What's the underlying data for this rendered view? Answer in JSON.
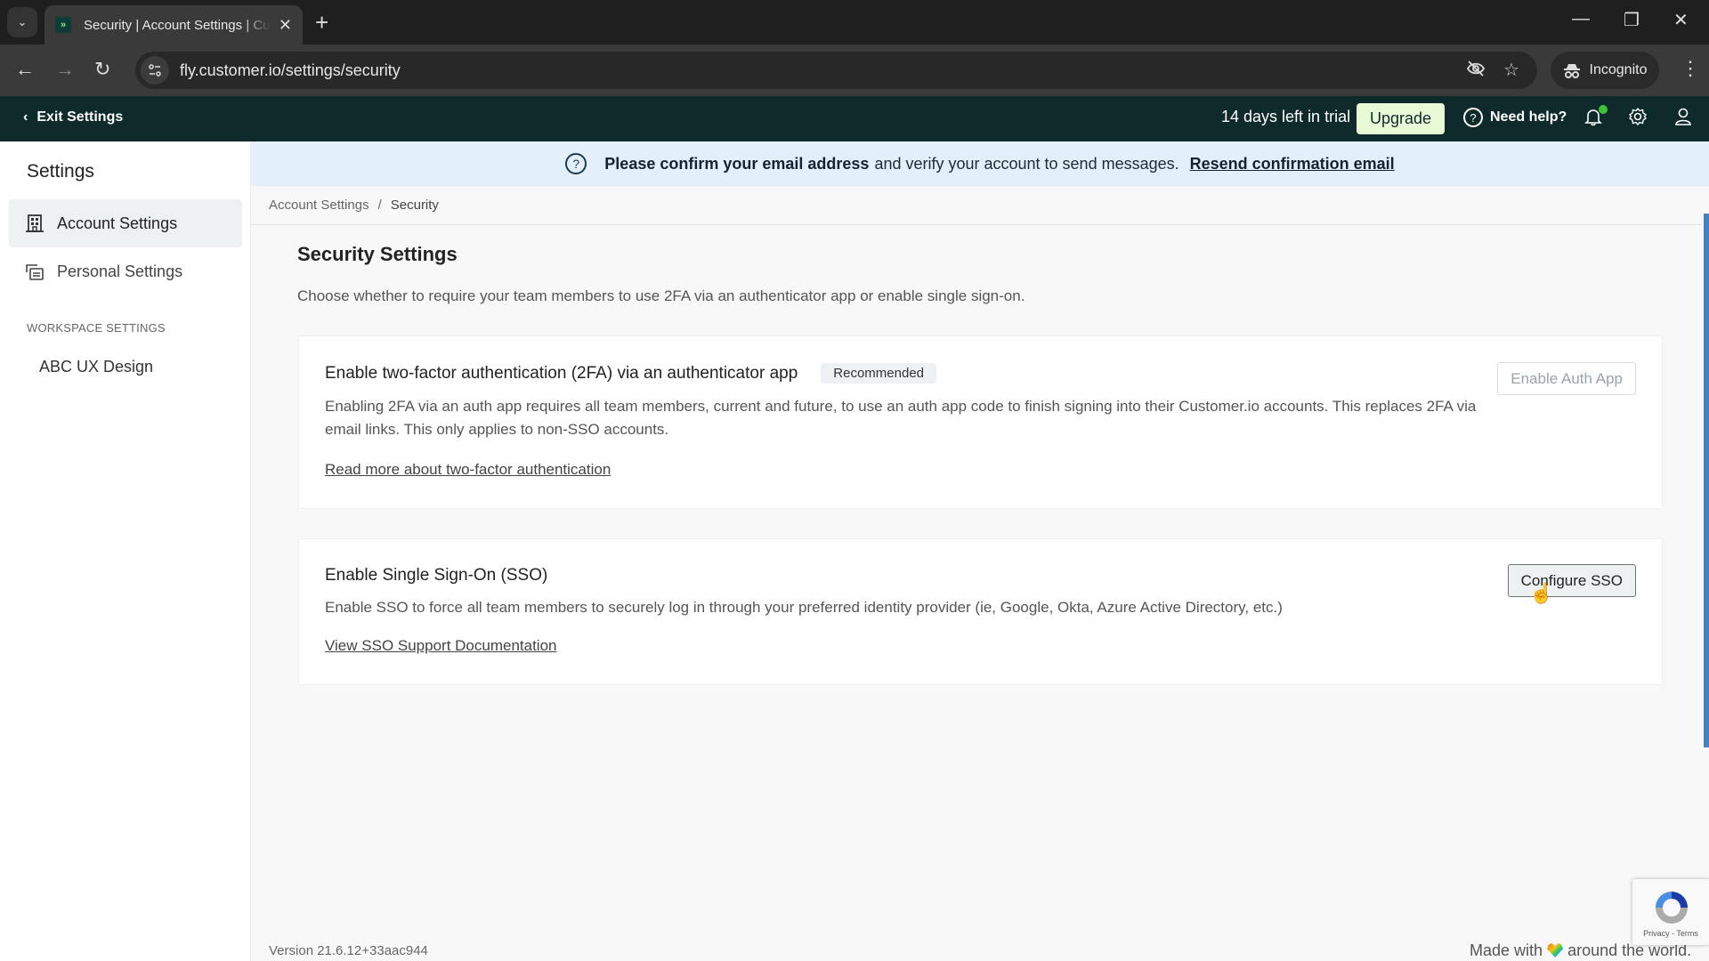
{
  "browser": {
    "tab_title": "Security | Account Settings | Customer.io",
    "tab_favicon_glyph": "»",
    "url": "fly.customer.io/settings/security",
    "incognito_label": "Incognito",
    "icons": {
      "tab_list": "chevron-down-icon",
      "close_tab": "✕",
      "new_tab": "+",
      "back": "←",
      "forward": "→",
      "reload": "↻",
      "site_info": "⚙",
      "eye_off": "👁",
      "bookmark": "☆",
      "incognito": "🕵",
      "menu": "⋮",
      "minimize": "—",
      "maximize": "❐",
      "close_window": "✕"
    }
  },
  "header": {
    "exit_label": "Exit Settings",
    "trial_text": "14 days left in trial",
    "upgrade_label": "Upgrade",
    "help_label": "Need help?",
    "notification_dot_color": "#3cc43a"
  },
  "sidebar": {
    "title": "Settings",
    "items": [
      {
        "label": "Account Settings",
        "icon": "building-icon",
        "active": true
      },
      {
        "label": "Personal Settings",
        "icon": "personal-card-icon",
        "active": false
      }
    ],
    "section_label": "WORKSPACE SETTINGS",
    "workspace_name": "ABC UX Design"
  },
  "banner": {
    "bold_text": "Please confirm your email address",
    "text": "and verify your account to send messages.",
    "link_label": "Resend confirmation email"
  },
  "breadcrumb": {
    "items": [
      "Account Settings",
      "Security"
    ],
    "separator": "/"
  },
  "page": {
    "title": "Security Settings",
    "description": "Choose whether to require your team members to use 2FA via an authenticator app or enable single sign-on."
  },
  "cards": [
    {
      "title": "Enable two-factor authentication (2FA) via an authenticator app",
      "badge": "Recommended",
      "description": "Enabling 2FA via an auth app requires all team members, current and future, to use an auth app code to finish signing into their Customer.io accounts. This replaces 2FA via email links. This only applies to non-SSO accounts.",
      "link_label": "Read more about two-factor authentication",
      "button_label": "Enable Auth App",
      "button_disabled": true
    },
    {
      "title": "Enable Single Sign-On (SSO)",
      "description": "Enable SSO to force all team members to securely log in through your preferred identity provider (ie, Google, Okta, Azure Active Directory, etc.)",
      "link_label": "View SSO Support Documentation",
      "button_label": "Configure SSO",
      "button_disabled": false
    }
  ],
  "footer": {
    "version": "Version 21.6.12+33aac944",
    "made_with_before": "Made with",
    "made_with_after": "around the world."
  },
  "recaptcha": {
    "links": "Privacy - Terms"
  },
  "colors": {
    "header_bg": "#0f2a2a",
    "upgrade_bg": "#e9fad6",
    "banner_bg": "#e3f0fb",
    "scrollbar": "#4a7fc1"
  }
}
